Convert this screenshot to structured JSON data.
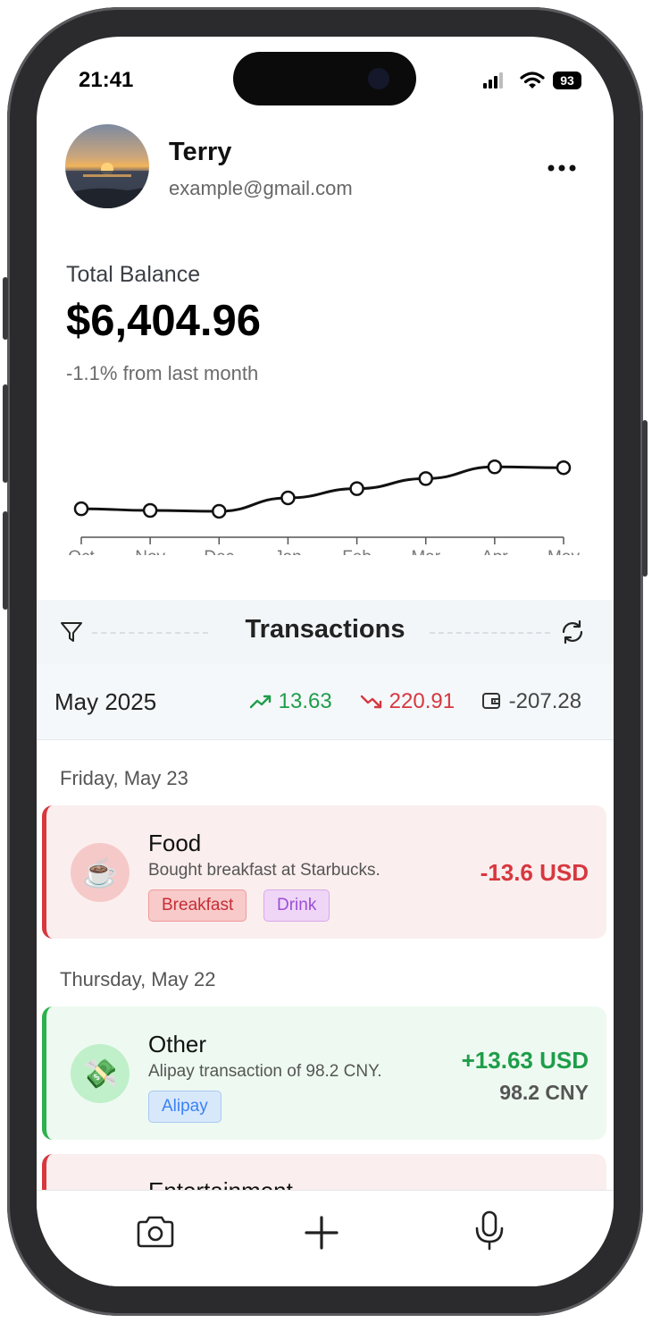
{
  "status": {
    "time": "21:41",
    "battery": "93"
  },
  "profile": {
    "name": "Terry",
    "email": "example@gmail.com"
  },
  "balance": {
    "label": "Total Balance",
    "value": "$6,404.96",
    "change": "-1.1% from last month"
  },
  "chart_data": {
    "type": "line",
    "categories": [
      "Oct",
      "Nov",
      "Dec",
      "Jan",
      "Feb",
      "Mar",
      "Apr",
      "May"
    ],
    "values": [
      0.18,
      0.16,
      0.15,
      0.31,
      0.42,
      0.54,
      0.68,
      0.67
    ]
  },
  "transactions": {
    "title": "Transactions",
    "month": "May 2025",
    "income": "13.63",
    "expense": "220.91",
    "net": "-207.28",
    "groups": [
      {
        "day": "Friday, May 23",
        "item": {
          "category": "Food",
          "description": "Bought breakfast at Starbucks.",
          "emoji": "☕",
          "tags": [
            "Breakfast",
            "Drink"
          ],
          "amount": "-13.6 USD"
        }
      },
      {
        "day": "Thursday, May 22",
        "item": {
          "category": "Other",
          "description": "Alipay transaction of 98.2 CNY.",
          "emoji": "💸",
          "tags": [
            "Alipay"
          ],
          "amount": "+13.63 USD",
          "secondary_amount": "98.2 CNY"
        }
      }
    ],
    "partial_next": {
      "category": "Entertainment"
    }
  },
  "colors": {
    "income": "#1f9d4a",
    "expense": "#d7373f",
    "accent_blue": "#3b82f6",
    "accent_purple": "#9b4fd6"
  },
  "icons": [
    "more-icon",
    "filter-icon",
    "refresh-icon",
    "trend-up-icon",
    "trend-down-icon",
    "wallet-icon",
    "camera-icon",
    "plus-icon",
    "microphone-icon"
  ]
}
